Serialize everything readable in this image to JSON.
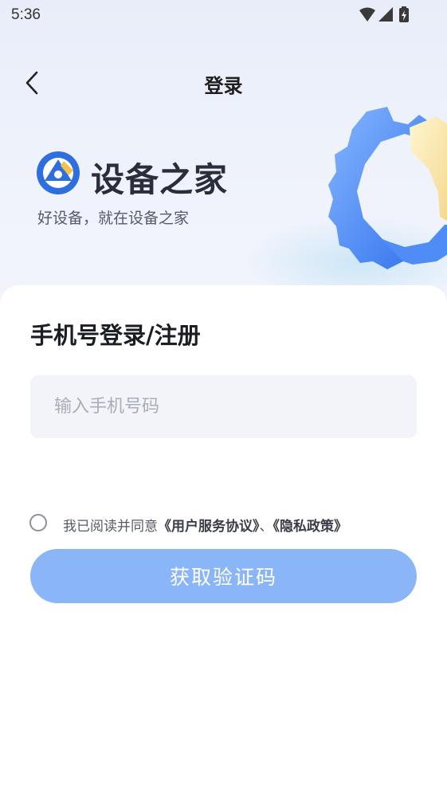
{
  "status_bar": {
    "time": "5:36",
    "icons": [
      "wifi-icon",
      "cell-signal-icon",
      "battery-charging-icon"
    ]
  },
  "nav": {
    "back_icon": "chevron-left-icon",
    "title": "登录"
  },
  "brand": {
    "name": "设备之家",
    "slogan": "好设备，就在设备之家",
    "logo_icon": "gear-logo-icon",
    "illustration_icon": "gear-illustration-icon"
  },
  "form": {
    "title": "手机号登录/注册",
    "phone_placeholder": "输入手机号码",
    "phone_value": "",
    "agreement": {
      "checked": false,
      "prefix": "我已阅读并同意",
      "terms_link": "《用户服务协议》",
      "separator": "、",
      "privacy_link": "《隐私政策》"
    },
    "submit_label": "获取验证码"
  },
  "colors": {
    "primary_button": "#8ab5f6",
    "brand_blue": "#2e6fe0",
    "brand_yellow": "#f4c24a",
    "input_background": "#f3f4f9"
  }
}
